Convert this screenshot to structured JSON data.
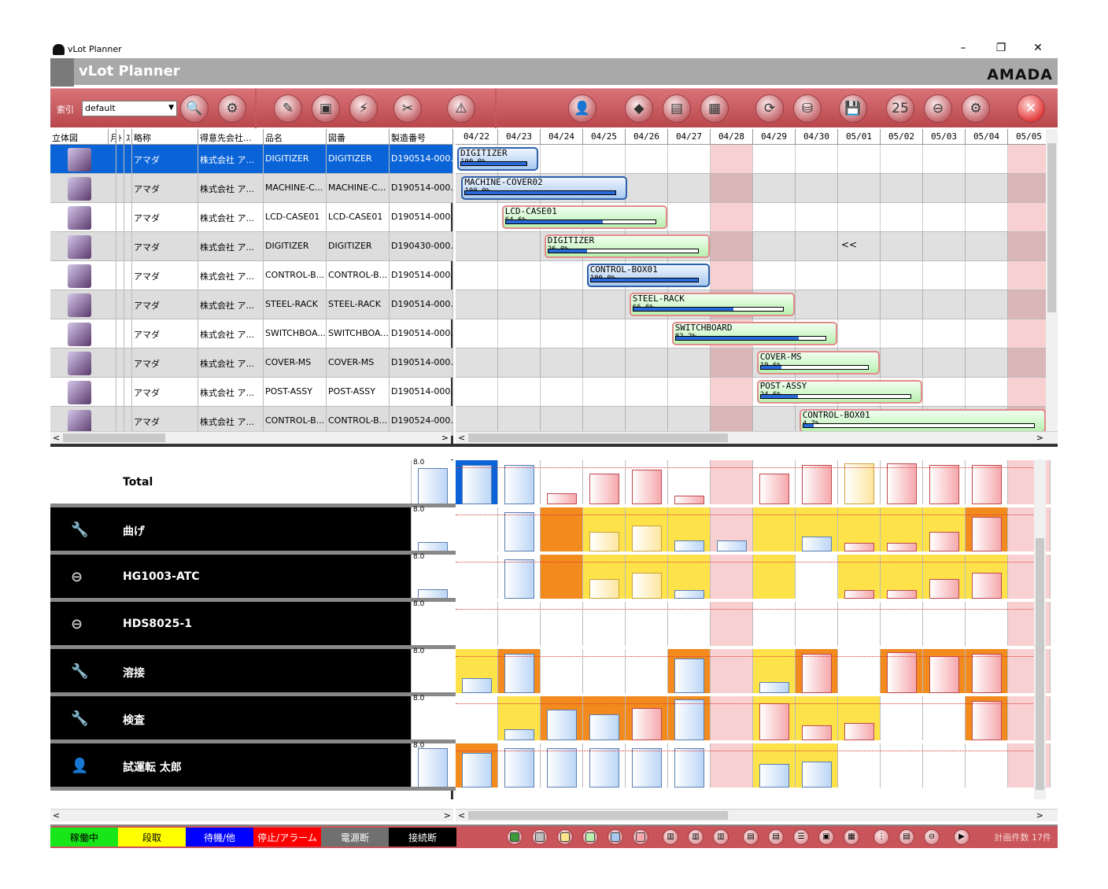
{
  "window": {
    "title": "vLot Planner",
    "app_name": "vLot Planner",
    "brand": "AMADA",
    "minimize": "–",
    "restore": "❐",
    "close": "✕"
  },
  "toolbar": {
    "index_label": "索引",
    "index_value": "default"
  },
  "list": {
    "headers": [
      "立体図",
      "月",
      "ﾄ",
      "ｽ",
      "略称",
      "得意先会社...",
      "品名",
      "図番",
      "製造番号"
    ],
    "rows": [
      {
        "short": "アマダ",
        "customer": "株式会社 ア...",
        "product": "DIGITIZER",
        "drawing": "DIGITIZER",
        "serial": "D190514-000..."
      },
      {
        "short": "アマダ",
        "customer": "株式会社 ア...",
        "product": "MACHINE-C...",
        "drawing": "MACHINE-C...",
        "serial": "D190514-000..."
      },
      {
        "short": "アマダ",
        "customer": "株式会社 ア...",
        "product": "LCD-CASE01",
        "drawing": "LCD-CASE01",
        "serial": "D190514-000..."
      },
      {
        "short": "アマダ",
        "customer": "株式会社 ア...",
        "product": "DIGITIZER",
        "drawing": "DIGITIZER",
        "serial": "D190430-000..."
      },
      {
        "short": "アマダ",
        "customer": "株式会社 ア...",
        "product": "CONTROL-B...",
        "drawing": "CONTROL-B...",
        "serial": "D190514-000..."
      },
      {
        "short": "アマダ",
        "customer": "株式会社 ア...",
        "product": "STEEL-RACK",
        "drawing": "STEEL-RACK",
        "serial": "D190514-000..."
      },
      {
        "short": "アマダ",
        "customer": "株式会社 ア...",
        "product": "SWITCHBOA...",
        "drawing": "SWITCHBOA...",
        "serial": "D190514-000..."
      },
      {
        "short": "アマダ",
        "customer": "株式会社 ア...",
        "product": "COVER-MS",
        "drawing": "COVER-MS",
        "serial": "D190514-000..."
      },
      {
        "short": "アマダ",
        "customer": "株式会社 ア...",
        "product": "POST-ASSY",
        "drawing": "POST-ASSY",
        "serial": "D190514-000..."
      },
      {
        "short": "アマダ",
        "customer": "株式会社 ア...",
        "product": "CONTROL-B...",
        "drawing": "CONTROL-B...",
        "serial": "D190524-000..."
      }
    ]
  },
  "gantt": {
    "dates": [
      "04/22",
      "04/23",
      "04/24",
      "04/25",
      "04/26",
      "04/27",
      "04/28",
      "04/29",
      "04/30",
      "05/01",
      "05/02",
      "05/03",
      "05/04",
      "05/05"
    ],
    "holidays": [
      6,
      13
    ],
    "marker": "<<",
    "bars": [
      {
        "label": "DIGITIZER",
        "pct": "100.0%",
        "progress": 1.0,
        "start": 0,
        "days": 1.9,
        "style": "blue"
      },
      {
        "label": "MACHINE-COVER02",
        "pct": "100.0%",
        "progress": 1.0,
        "start": 0.1,
        "days": 3.9,
        "style": "blue"
      },
      {
        "label": "LCD-CASE01",
        "pct": "64.6%",
        "progress": 0.646,
        "start": 1.05,
        "days": 3.9,
        "style": "green"
      },
      {
        "label": "DIGITIZER",
        "pct": "26.0%",
        "progress": 0.26,
        "start": 2.05,
        "days": 3.9,
        "style": "green"
      },
      {
        "label": "CONTROL-BOX01",
        "pct": "100.0%",
        "progress": 1.0,
        "start": 3.05,
        "days": 2.9,
        "style": "blue"
      },
      {
        "label": "STEEL-RACK",
        "pct": "66.6%",
        "progress": 0.666,
        "start": 4.05,
        "days": 3.9,
        "style": "green"
      },
      {
        "label": "SWITCHBOARD",
        "pct": "82.2%",
        "progress": 0.822,
        "start": 5.05,
        "days": 3.9,
        "style": "green"
      },
      {
        "label": "COVER-MS",
        "pct": "19.6%",
        "progress": 0.196,
        "start": 7.05,
        "days": 2.9,
        "style": "green"
      },
      {
        "label": "POST-ASSY",
        "pct": "24.6%",
        "progress": 0.246,
        "start": 7.05,
        "days": 3.9,
        "style": "green"
      },
      {
        "label": "CONTROL-BOX01",
        "pct": "4.7%",
        "progress": 0.047,
        "start": 8.05,
        "days": 6,
        "style": "green"
      }
    ]
  },
  "resources": [
    {
      "name": "Total",
      "icon": "total",
      "cap": "8.0"
    },
    {
      "name": "曲げ",
      "icon": "wrench-icon",
      "cap": "8.0"
    },
    {
      "name": "HG1003-ATC",
      "icon": "machine-icon",
      "cap": "8.0"
    },
    {
      "name": "HDS8025-1",
      "icon": "machine-icon",
      "cap": "8.0"
    },
    {
      "name": "溶接",
      "icon": "wrench-icon",
      "cap": "8.0"
    },
    {
      "name": "検査",
      "icon": "wrench-icon",
      "cap": "8.0"
    },
    {
      "name": "試運転 太郎",
      "icon": "person-icon",
      "cap": "8.0"
    }
  ],
  "status": {
    "legend": [
      {
        "label": "稼働中",
        "color": "#19e619"
      },
      {
        "label": "段取",
        "color": "#ffff00"
      },
      {
        "label": "待機/他",
        "color": "#0000ff"
      },
      {
        "label": "停止/アラーム",
        "color": "#ff0000"
      },
      {
        "label": "電源断",
        "color": "#707070"
      },
      {
        "label": "接続断",
        "color": "#000000"
      }
    ],
    "plan_count": "計画件数 17件"
  },
  "scroll": {
    "left": "<",
    "right": ">",
    "up": "^",
    "down": "v"
  }
}
